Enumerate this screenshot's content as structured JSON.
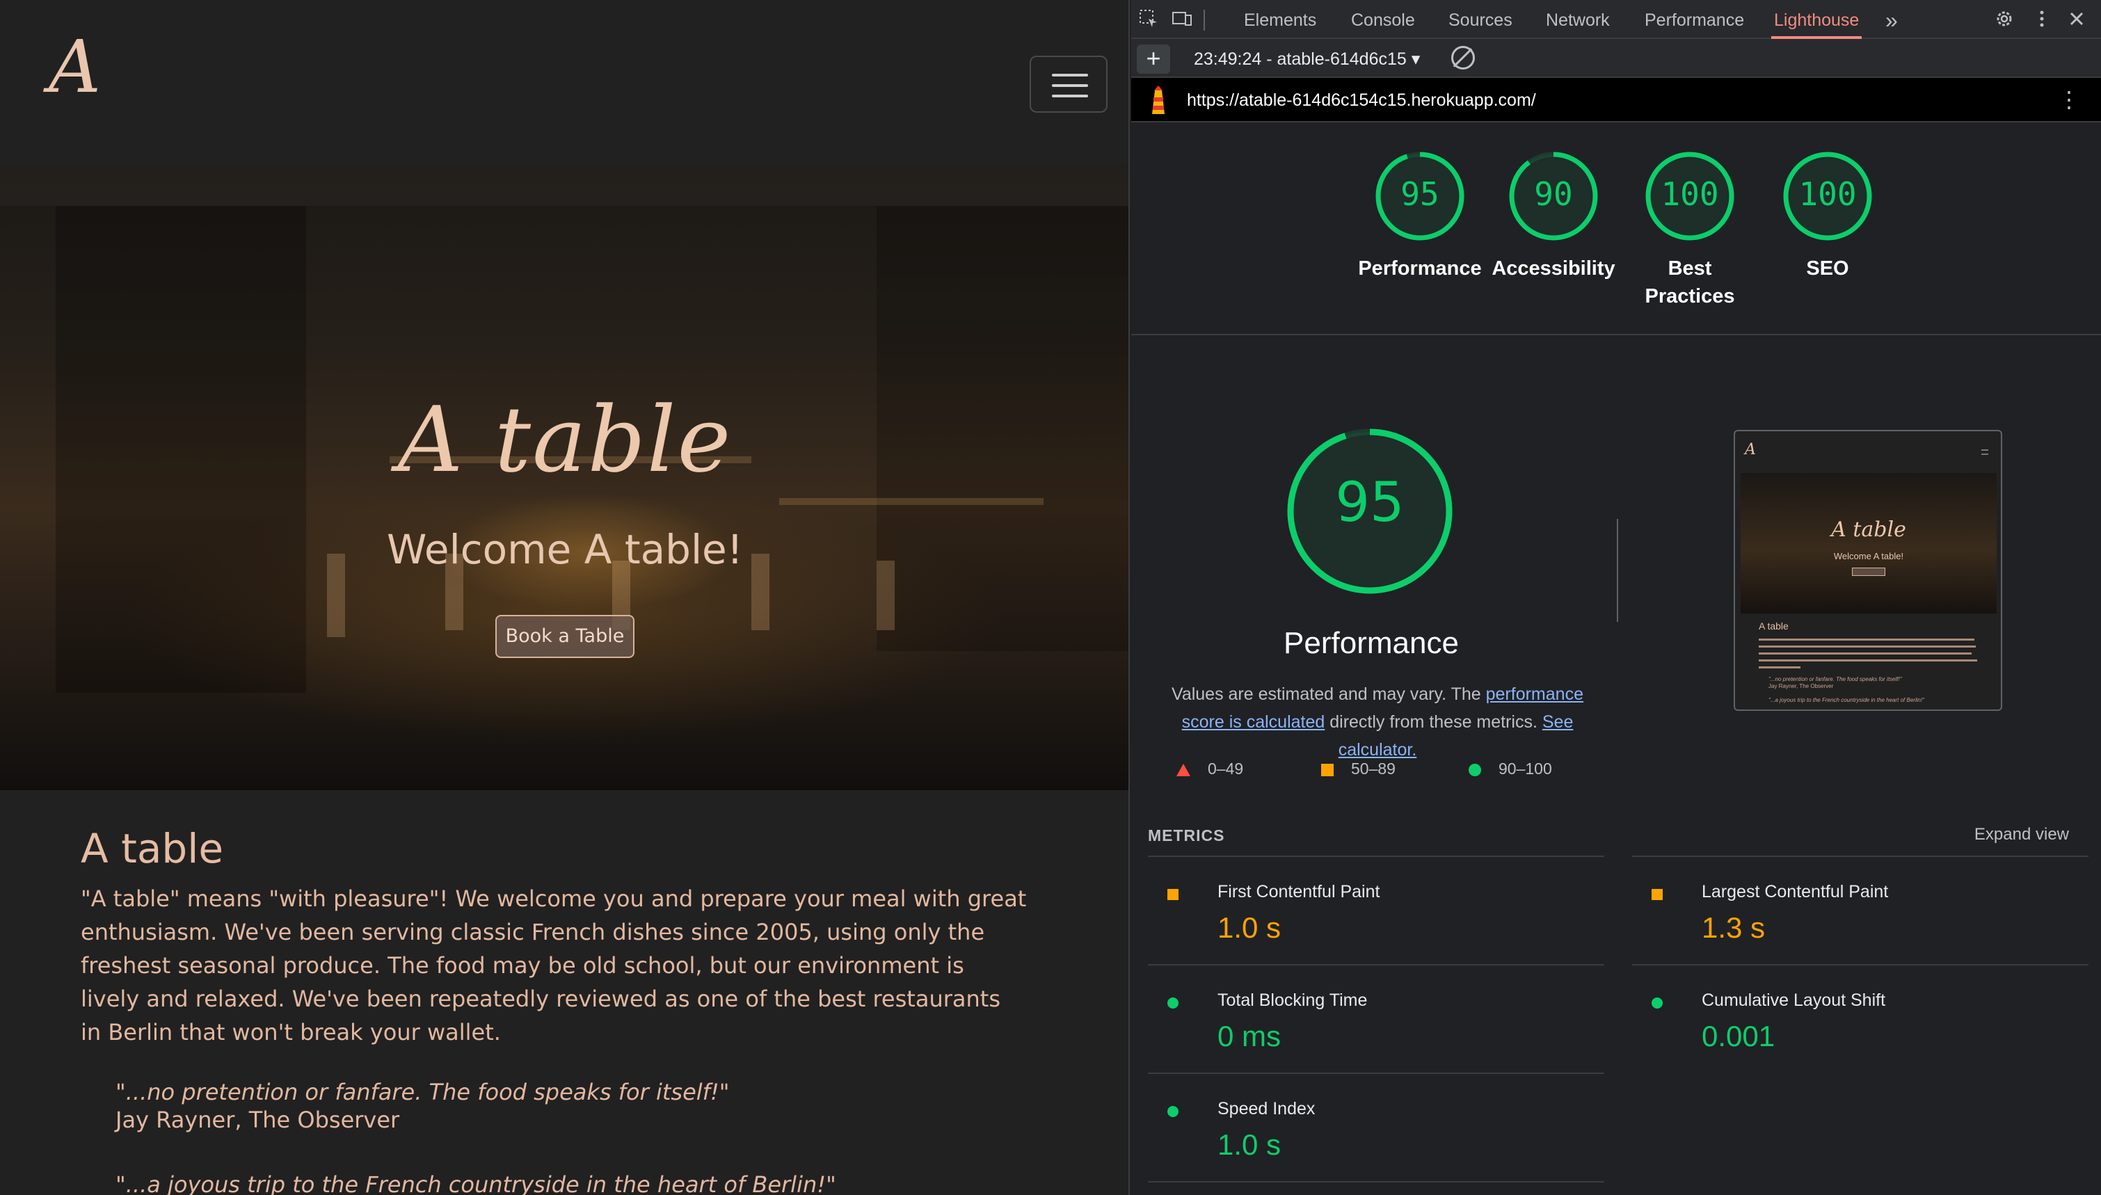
{
  "site": {
    "logo": "A",
    "hero_title": "A table",
    "hero_subtitle": "Welcome A table!",
    "hero_button": "Book a Table",
    "about_heading": "A table",
    "about_text": "\"A table\" means \"with pleasure\"! We welcome you and prepare your meal with great enthusiasm. We've been serving classic French dishes since 2005, using only the freshest seasonal produce. The food may be old school, but our environment is lively and relaxed. We've been repeatedly reviewed as one of the best restaurants in Berlin that won't break your wallet.",
    "quote1_text": "\"...no pretention or fanfare. The food speaks for itself!\"",
    "quote1_author": "Jay Rayner, The Observer",
    "quote2_text": "\"...a joyous trip to the French countryside in the heart of Berlin!\""
  },
  "devtools": {
    "tabs": [
      "Elements",
      "Console",
      "Sources",
      "Network",
      "Performance",
      "Lighthouse"
    ],
    "active_tab": "Lighthouse",
    "more_tabs": "»",
    "report_selector": "23:49:24 - atable-614d6c15",
    "url": "https://atable-614d6c154c15.herokuapp.com/",
    "scores": [
      {
        "label": "Performance",
        "value": "95",
        "fraction": 0.95
      },
      {
        "label": "Accessibility",
        "value": "90",
        "fraction": 0.9
      },
      {
        "label": "Best Practices",
        "value": "100",
        "fraction": 1.0
      },
      {
        "label": "SEO",
        "value": "100",
        "fraction": 1.0
      }
    ],
    "performance": {
      "score": "95",
      "fraction": 0.95,
      "title": "Performance",
      "note_pre": "Values are estimated and may vary. The ",
      "note_link1": "performance score is calculated",
      "note_mid": " directly from these metrics. ",
      "note_link2": "See calculator.",
      "legend": [
        "0–49",
        "50–89",
        "90–100"
      ]
    },
    "thumbnail": {
      "logo": "A",
      "hero_title": "A table",
      "hero_subtitle": "Welcome A table!",
      "heading": "A table",
      "quote1": "\"...no pretention or fanfare. The food speaks for itself!\"",
      "quote1_author": "Jay Rayner, The Observer",
      "quote2": "\"...a joyous trip to the French countryside in the heart of Berlin!\""
    },
    "metrics": {
      "header": "METRICS",
      "expand": "Expand view",
      "items": [
        {
          "name": "First Contentful Paint",
          "value": "1.0 s",
          "status": "average"
        },
        {
          "name": "Largest Contentful Paint",
          "value": "1.3 s",
          "status": "average"
        },
        {
          "name": "Total Blocking Time",
          "value": "0 ms",
          "status": "pass"
        },
        {
          "name": "Cumulative Layout Shift",
          "value": "0.001",
          "status": "pass"
        },
        {
          "name": "Speed Index",
          "value": "1.0 s",
          "status": "pass"
        }
      ]
    },
    "colors": {
      "pass": "#0cce6b",
      "average": "#ffa400",
      "fail": "#ff4e42",
      "accent_tab": "#f28b82",
      "link": "#8ab4f8"
    }
  }
}
